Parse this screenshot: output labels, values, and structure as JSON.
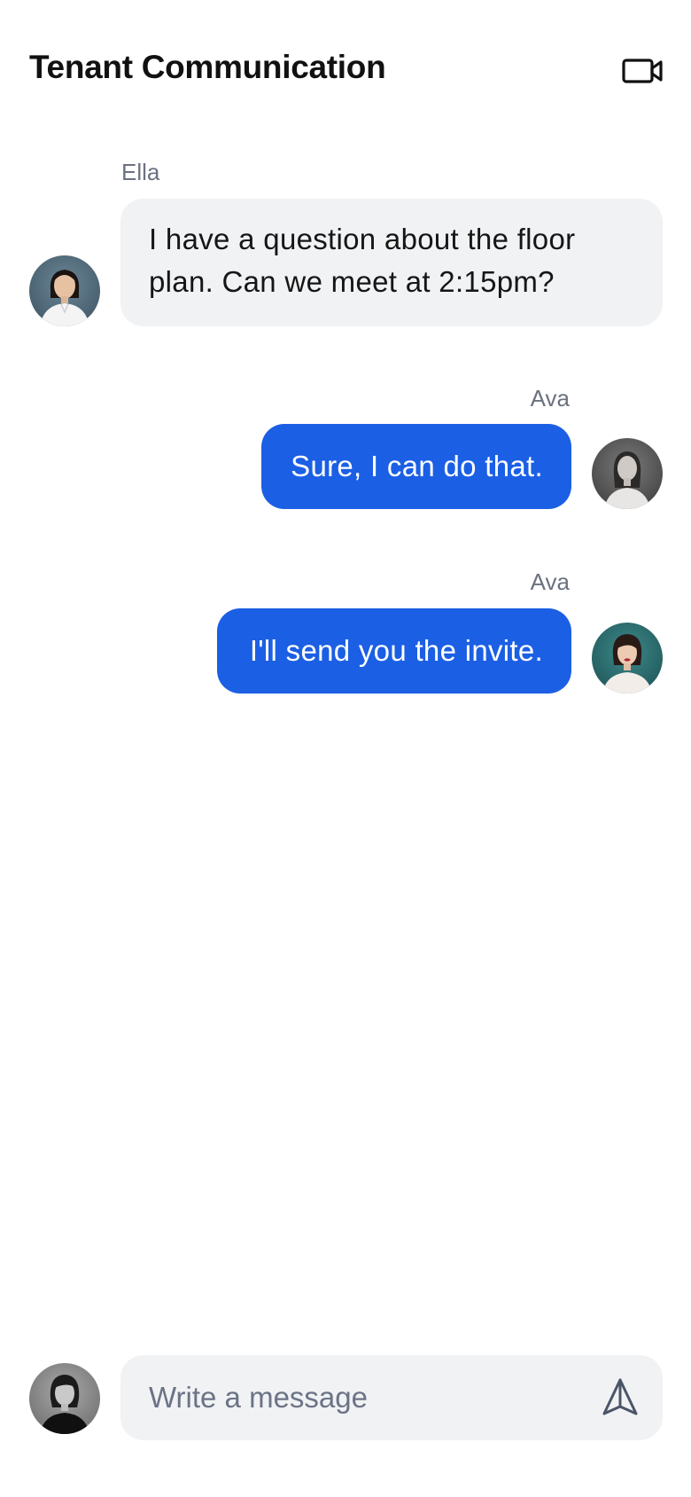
{
  "header": {
    "title": "Tenant Communication",
    "video_icon": "video-camera-icon"
  },
  "messages": [
    {
      "sender": "Ella",
      "text": "I have a question about the floor plan. Can we meet at 2:15pm?",
      "direction": "incoming",
      "avatar": "avatar-ella"
    },
    {
      "sender": "Ava",
      "text": "Sure, I can do that.",
      "direction": "outgoing",
      "avatar": "avatar-ava"
    },
    {
      "sender": "Ava",
      "text": "I'll send you the invite.",
      "direction": "outgoing",
      "avatar": "avatar-ava-alt"
    }
  ],
  "composer": {
    "placeholder": "Write a message",
    "value": "",
    "send_icon": "send-icon",
    "user_avatar": "avatar-current-user"
  },
  "colors": {
    "outgoing_bubble": "#1b5fe4",
    "incoming_bubble": "#f1f2f4",
    "sender_label": "#6b7280",
    "background": "#ffffff"
  }
}
